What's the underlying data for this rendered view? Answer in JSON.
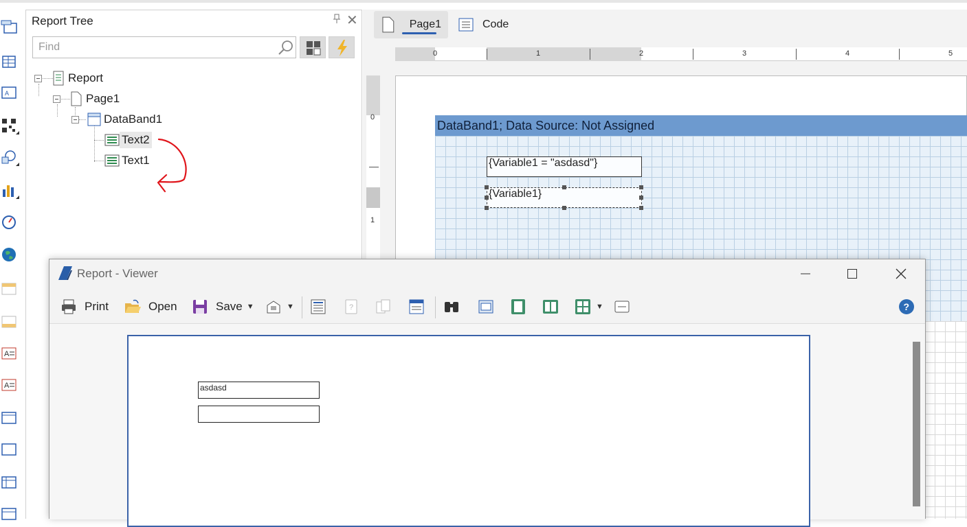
{
  "tree_panel": {
    "title": "Report Tree",
    "find_placeholder": "Find",
    "nodes": [
      {
        "label": "Report"
      },
      {
        "label": "Page1"
      },
      {
        "label": "DataBand1"
      },
      {
        "label": "Text2",
        "selected": true
      },
      {
        "label": "Text1"
      }
    ]
  },
  "designer": {
    "tabs": [
      {
        "label": "Page1",
        "active": true
      },
      {
        "label": "Code"
      }
    ],
    "hruler": [
      "0",
      "1",
      "2",
      "3",
      "4",
      "5"
    ],
    "vruler": [
      "0",
      "1"
    ],
    "band_header": "DataBand1; Data Source: Not Assigned",
    "text2_content": "{Variable1 = \"asdasd\"}",
    "text1_content": "{Variable1}"
  },
  "viewer": {
    "title": "Report - Viewer",
    "toolbar": {
      "print": "Print",
      "open": "Open",
      "save": "Save"
    },
    "page": {
      "box1_text": "asdasd",
      "box2_text": ""
    }
  },
  "colors": {
    "band_header": "#6d9acf",
    "grid_bg": "#e8f1f9",
    "accent": "#2d5fb0",
    "annotation": "#e0151b"
  }
}
